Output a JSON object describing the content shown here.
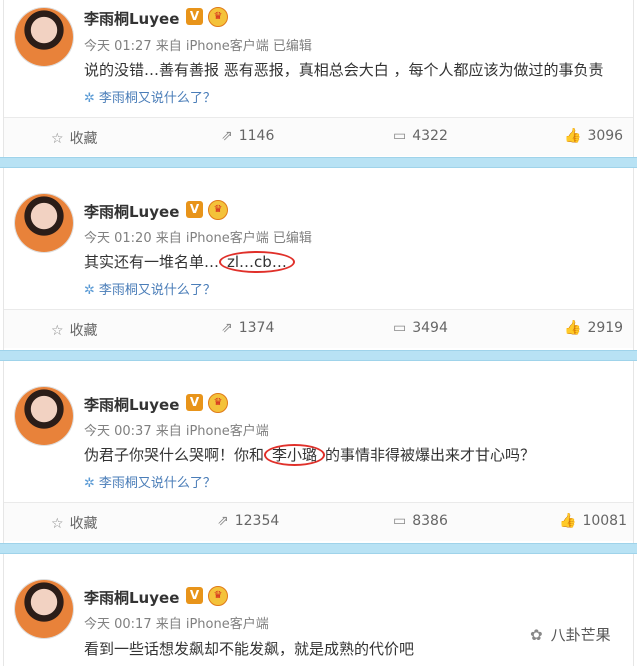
{
  "posts": [
    {
      "author": "李雨桐Luyee",
      "verified": "V",
      "meta": "今天 01:27 来自 iPhone客户端   已编辑",
      "text_before": "说的没错…善有善报 恶有恶报，真相总会大白 ，每个人都应该为做过的事负责",
      "highlight": "",
      "text_after": "",
      "more": "李雨桐又说什么了？",
      "favorite": "收藏",
      "reposts": "1146",
      "comments": "4322",
      "likes": "3096"
    },
    {
      "author": "李雨桐Luyee",
      "verified": "V",
      "meta": "今天 01:20 来自 iPhone客户端   已编辑",
      "text_before": "其实还有一堆名单…",
      "highlight": "zl…cb…",
      "text_after": "",
      "more": "李雨桐又说什么了？",
      "favorite": "收藏",
      "reposts": "1374",
      "comments": "3494",
      "likes": "2919"
    },
    {
      "author": "李雨桐Luyee",
      "verified": "V",
      "meta": "今天 00:37 来自 iPhone客户端",
      "text_before": "伪君子你哭什么哭啊！你和",
      "highlight": "李小璐",
      "text_after": "的事情非得被爆出来才甘心吗？",
      "more": "李雨桐又说什么了？",
      "favorite": "收藏",
      "reposts": "12354",
      "comments": "8386",
      "likes": "10081"
    },
    {
      "author": "李雨桐Luyee",
      "verified": "V",
      "meta": "今天 00:17 来自 iPhone客户端",
      "text_before": "看到一些话想发飙却不能发飙，就是成熟的代价吧",
      "highlight": "",
      "text_after": "",
      "more": "",
      "favorite": "",
      "reposts": "",
      "comments": "",
      "likes": ""
    }
  ],
  "watermark": "八卦芒果",
  "icons": {
    "favorite": "star-icon",
    "repost": "repost-icon",
    "comment": "comment-icon",
    "like": "thumbs-up-icon",
    "more": "sparkle-icon",
    "watermark": "wechat-icon"
  },
  "colors": {
    "separator": "#b8e2f4",
    "link": "#4a7db8",
    "highlight_circle": "#e0302a",
    "verified_badge": "#e8941a"
  }
}
